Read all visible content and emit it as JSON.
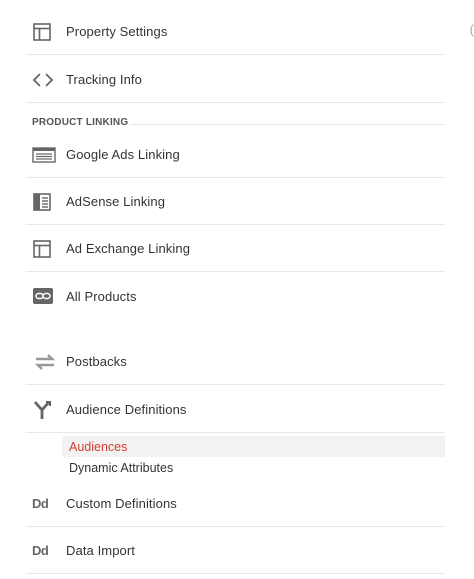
{
  "menu": {
    "top_items": [
      {
        "label": "Property Settings",
        "icon": "property-settings-icon"
      },
      {
        "label": "Tracking Info",
        "icon": "code-icon"
      }
    ],
    "section_title": "PRODUCT LINKING",
    "linking_items": [
      {
        "label": "Google Ads Linking",
        "icon": "google-ads-icon"
      },
      {
        "label": "AdSense Linking",
        "icon": "adsense-icon"
      },
      {
        "label": "Ad Exchange Linking",
        "icon": "ad-exchange-icon"
      },
      {
        "label": "All Products",
        "icon": "link-icon"
      }
    ],
    "other_items": [
      {
        "label": "Postbacks",
        "icon": "postbacks-icon"
      },
      {
        "label": "Audience Definitions",
        "icon": "audience-icon"
      }
    ],
    "audience_sub_items": [
      {
        "label": "Audiences",
        "active": true
      },
      {
        "label": "Dynamic Attributes",
        "active": false
      }
    ],
    "bottom_items": [
      {
        "label": "Custom Definitions",
        "icon_text": "Dd"
      },
      {
        "label": "Data Import",
        "icon_text": "Dd"
      }
    ],
    "edge_char": "("
  },
  "colors": {
    "active_text": "#d23f31",
    "active_bg": "#f2f2f2",
    "icon": "#666666",
    "divider": "#e8e8e8"
  }
}
